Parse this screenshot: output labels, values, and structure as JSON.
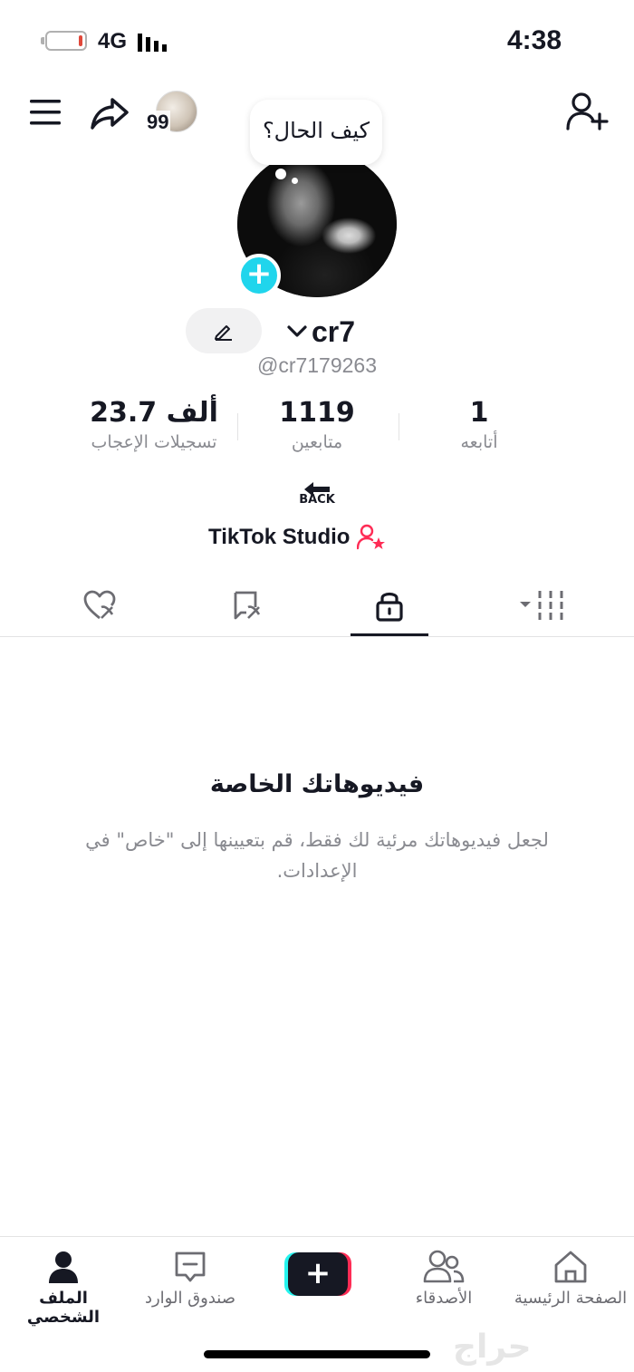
{
  "status_bar": {
    "time": "4:38",
    "network": "4G"
  },
  "top_bar": {
    "avatar_count": "99"
  },
  "profile": {
    "bubble_text": "كيف الحال؟",
    "name": "cr7",
    "handle": "@cr7179263"
  },
  "stats": [
    {
      "value": "23.7 ألف",
      "label": "تسجيلات الإعجاب"
    },
    {
      "value": "1119",
      "label": "متابعين"
    },
    {
      "value": "1",
      "label": "أتابعه"
    }
  ],
  "back_label": "BACK",
  "studio_label": "TikTok Studio",
  "empty_state": {
    "title": "فيديوهاتك الخاصة",
    "description": "لجعل فيديوهاتك مرئية لك فقط، قم بتعيينها إلى \"خاص\" في الإعدادات."
  },
  "bottom_nav": {
    "profile": "الملف الشخصي",
    "inbox": "صندوق الوارد",
    "friends": "الأصدقاء",
    "home": "الصفحة الرئيسية"
  },
  "watermark": "حراج",
  "colors": {
    "accent_cyan": "#20d5ec",
    "accent_pink": "#fe2c55",
    "text_primary": "#161823",
    "text_secondary": "#8a8b91"
  }
}
